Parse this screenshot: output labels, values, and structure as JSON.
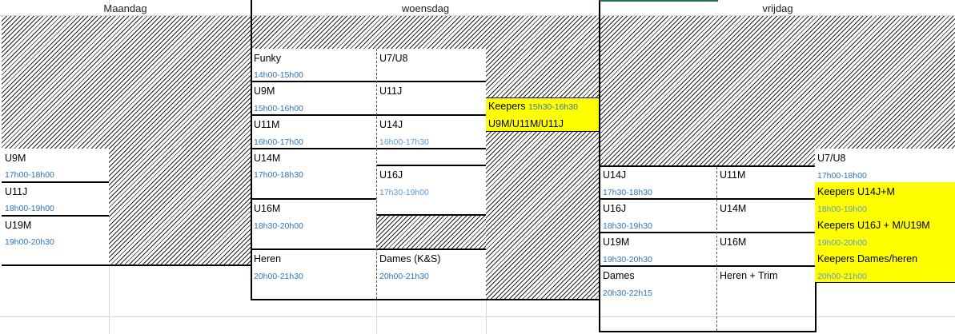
{
  "days": {
    "mon": "Maandag",
    "wed": "woensdag",
    "fri": "vrijdag"
  },
  "maandag": {
    "slots": [
      {
        "group": "U9M",
        "time": "17h00-18h00"
      },
      {
        "group": "U11J",
        "time": "18h00-19h00"
      },
      {
        "group": "U19M",
        "time": "19h00-20h30"
      }
    ]
  },
  "woensdag": {
    "col1": [
      {
        "group": "Funky",
        "time": "14h00-15h00"
      },
      {
        "group": "U9M",
        "time": "15h00-16h00"
      },
      {
        "group": "U11M",
        "time": "16h00-17h00"
      },
      {
        "group": "U14M",
        "time": "17h00-18h30"
      },
      {
        "group": "U16M",
        "time": "18h30-20h00"
      },
      {
        "group": "Heren",
        "time": "20h00-21h30"
      }
    ],
    "col2": [
      {
        "group": "U7/U8",
        "time": ""
      },
      {
        "group": "U11J",
        "time": ""
      },
      {
        "group": "U14J",
        "time": "16h00-17h30"
      },
      {
        "group": "U16J",
        "time": "17h30-19h00"
      },
      {
        "group": "Dames (K&S)",
        "time": "20h00-21h30"
      }
    ],
    "keepers": {
      "label": "Keepers",
      "time": "15h30-16h30",
      "groups": "U9M/U11M/U11J"
    }
  },
  "vrijdag": {
    "col1": [
      {
        "group": "U14J",
        "time": "17h30-18h30"
      },
      {
        "group": "U16J",
        "time": "18h30-19h30"
      },
      {
        "group": "U19M",
        "time": "19h30-20h30"
      },
      {
        "group": "Dames",
        "time": "20h30-22h15"
      }
    ],
    "col2": [
      {
        "group": "U11M"
      },
      {
        "group": "U14M"
      },
      {
        "group": "U16M"
      },
      {
        "group": "Heren + Trim"
      }
    ],
    "col3": [
      {
        "group": "U7/U8",
        "time": "17h00-18h00"
      },
      {
        "group": "Keepers U14J+M",
        "time": "18h00-19h00"
      },
      {
        "group": "Keepers U16J + M/U19M",
        "time": "19h00-20h00"
      },
      {
        "group": "Keepers Dames/heren",
        "time": "20h00-21h00"
      }
    ]
  }
}
